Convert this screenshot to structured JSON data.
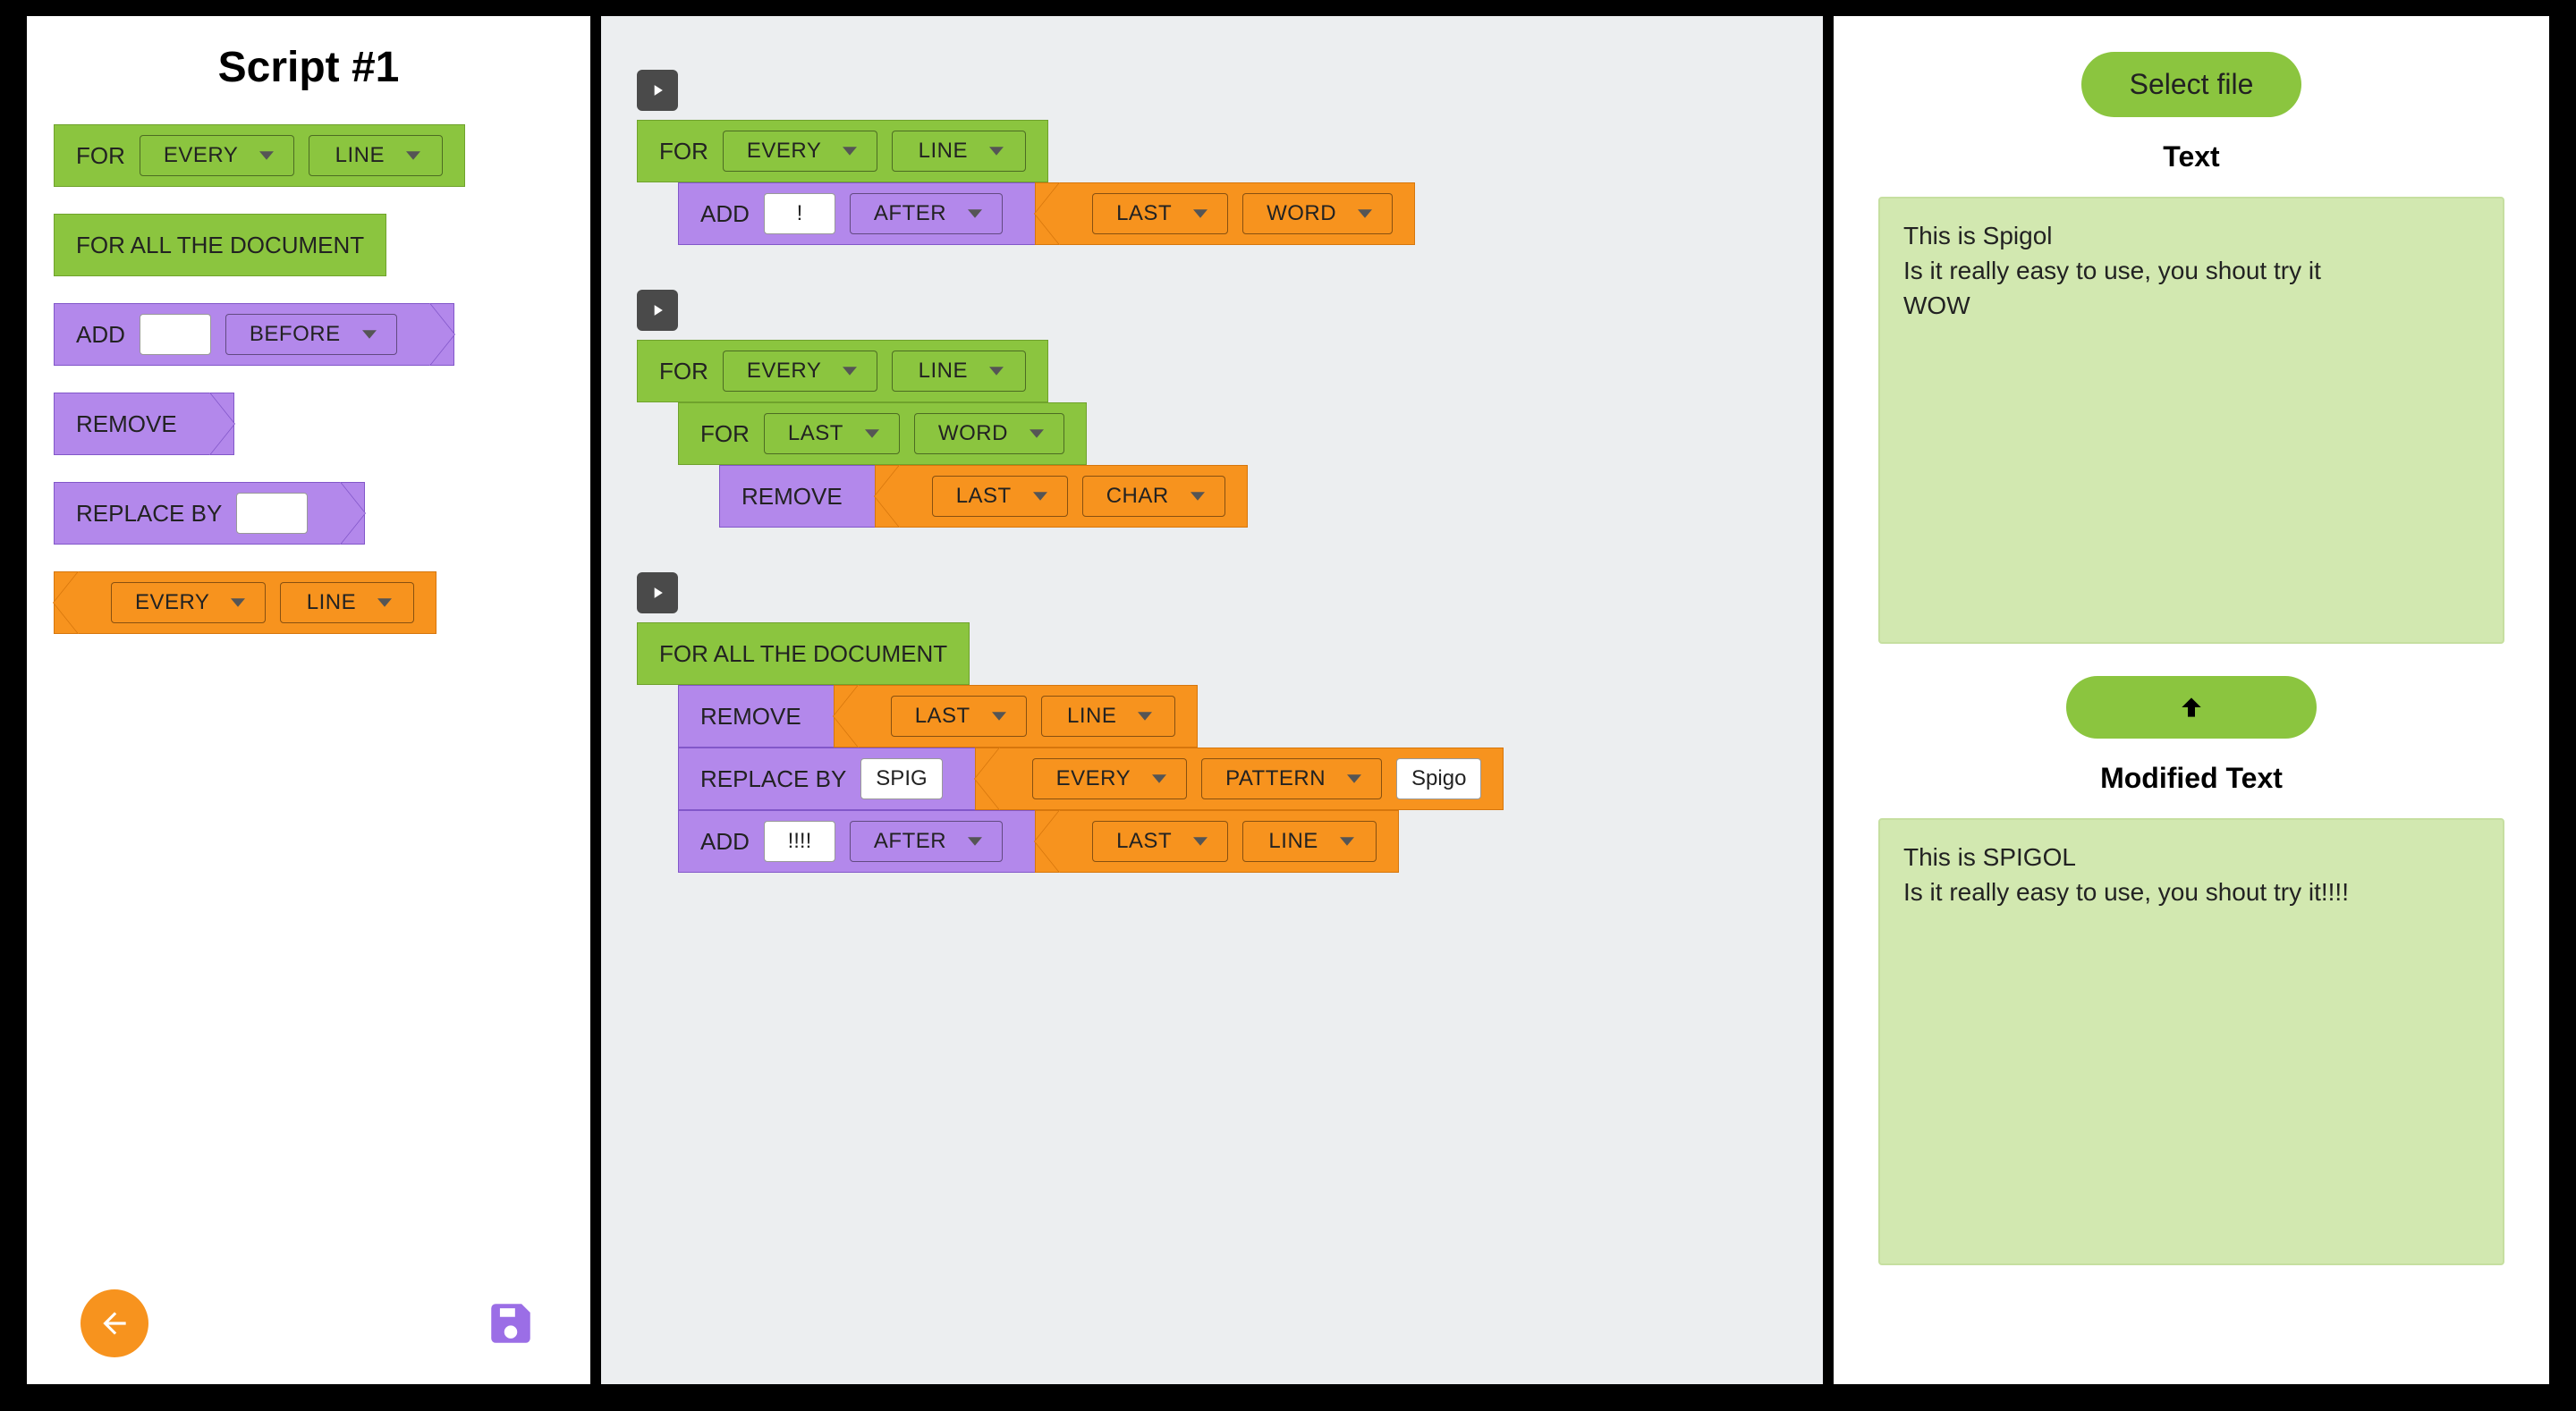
{
  "palette": {
    "title": "Script #1",
    "blocks": {
      "for": {
        "label": "FOR",
        "dd1": "EVERY",
        "dd2": "LINE"
      },
      "for_all": {
        "label": "FOR ALL THE DOCUMENT"
      },
      "add": {
        "label": "ADD",
        "value": "",
        "pos": "BEFORE"
      },
      "remove": {
        "label": "REMOVE"
      },
      "replace": {
        "label": "REPLACE BY",
        "value": ""
      },
      "selector": {
        "dd1": "EVERY",
        "dd2": "LINE"
      }
    }
  },
  "scripts": [
    {
      "rows": [
        {
          "indent": 0,
          "type": "for",
          "dd1": "EVERY",
          "dd2": "LINE"
        },
        {
          "indent": 1,
          "type": "add",
          "value": "!",
          "pos": "AFTER",
          "sel": {
            "dd1": "LAST",
            "dd2": "WORD"
          }
        }
      ]
    },
    {
      "rows": [
        {
          "indent": 0,
          "type": "for",
          "dd1": "EVERY",
          "dd2": "LINE"
        },
        {
          "indent": 1,
          "type": "for",
          "dd1": "LAST",
          "dd2": "WORD"
        },
        {
          "indent": 2,
          "type": "remove",
          "sel": {
            "dd1": "LAST",
            "dd2": "CHAR"
          }
        }
      ]
    },
    {
      "rows": [
        {
          "indent": 0,
          "type": "for_all"
        },
        {
          "indent": 1,
          "type": "remove",
          "sel": {
            "dd1": "LAST",
            "dd2": "LINE"
          }
        },
        {
          "indent": 1,
          "type": "replace",
          "value": "SPIG",
          "sel": {
            "dd1": "EVERY",
            "dd2": "PATTERN",
            "txt": "Spigo"
          }
        },
        {
          "indent": 1,
          "type": "add",
          "value": "!!!!",
          "pos": "AFTER",
          "sel": {
            "dd1": "LAST",
            "dd2": "LINE"
          }
        }
      ]
    }
  ],
  "right": {
    "select_file": "Select file",
    "text_h": "Text",
    "text": "This is Spigol\nIs it really easy to use, you shout try it\nWOW",
    "mod_h": "Modified Text",
    "mod": "This is SPIGOL\nIs it really easy to use, you shout try it!!!!"
  },
  "labels": {
    "FOR": "FOR",
    "FOR_ALL": "FOR ALL THE DOCUMENT",
    "ADD": "ADD",
    "REMOVE": "REMOVE",
    "REPLACE": "REPLACE BY"
  }
}
